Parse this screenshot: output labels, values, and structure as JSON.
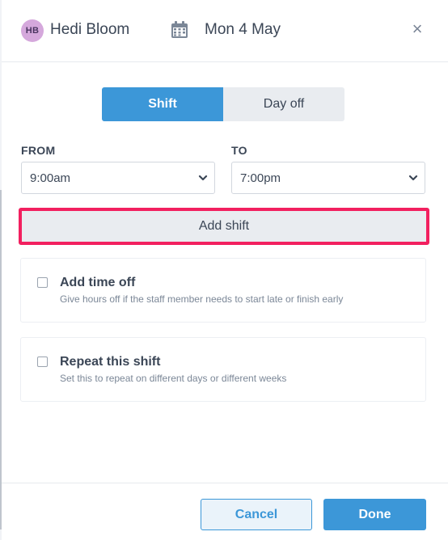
{
  "header": {
    "avatar_initials": "HB",
    "staff_name": "Hedi Bloom",
    "date": "Mon 4 May",
    "close_icon": "close-icon",
    "close_glyph": "×"
  },
  "type_toggle": {
    "options": [
      {
        "label": "Shift",
        "selected": true
      },
      {
        "label": "Day off",
        "selected": false
      }
    ]
  },
  "time_range": {
    "from": {
      "label": "FROM",
      "value": "9:00am"
    },
    "to": {
      "label": "TO",
      "value": "7:00pm"
    }
  },
  "add_shift_label": "Add shift",
  "options": [
    {
      "title": "Add time off",
      "description": "Give hours off if the staff member needs to start late or finish early",
      "checked": false
    },
    {
      "title": "Repeat this shift",
      "description": "Set this to repeat on different days or different weeks",
      "checked": false
    }
  ],
  "footer": {
    "cancel_label": "Cancel",
    "done_label": "Done"
  },
  "colors": {
    "accent": "#3c97d8",
    "highlight_border": "#f2205f",
    "avatar_bg": "#d5a8dc"
  }
}
